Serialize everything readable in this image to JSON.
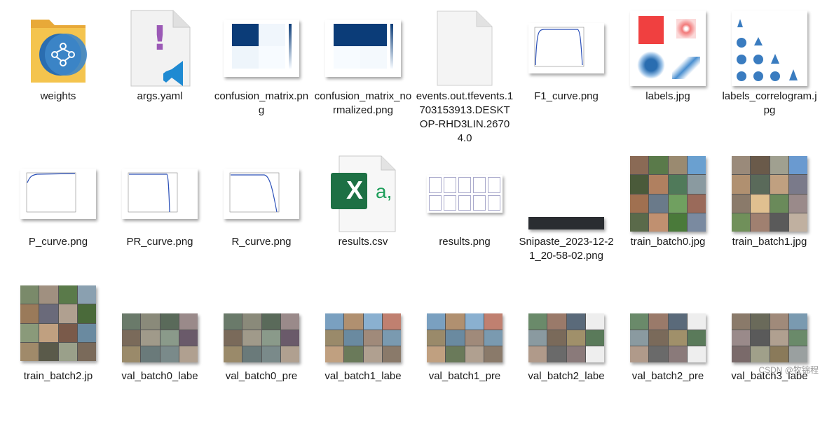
{
  "files": [
    {
      "name": "weights",
      "icon": "folder-icon"
    },
    {
      "name": "args.yaml",
      "icon": "yaml-file-icon"
    },
    {
      "name": "confusion_matrix.png",
      "icon": "confusion-matrix-thumbnail"
    },
    {
      "name": "confusion_matrix_normalized.png",
      "icon": "confusion-matrix-normalized-thumbnail"
    },
    {
      "name": "events.out.tfevents.1703153913.DESKTOP-RHD3LIN.26704.0",
      "icon": "blank-file-icon"
    },
    {
      "name": "F1_curve.png",
      "icon": "f1-curve-thumbnail"
    },
    {
      "name": "labels.jpg",
      "icon": "labels-thumbnail"
    },
    {
      "name": "labels_correlogram.jpg",
      "icon": "correlogram-thumbnail"
    },
    {
      "name": "P_curve.png",
      "icon": "p-curve-thumbnail"
    },
    {
      "name": "PR_curve.png",
      "icon": "pr-curve-thumbnail"
    },
    {
      "name": "R_curve.png",
      "icon": "r-curve-thumbnail"
    },
    {
      "name": "results.csv",
      "icon": "excel-csv-icon",
      "glyph": "X",
      "suffix": "a,"
    },
    {
      "name": "results.png",
      "icon": "results-thumbnail"
    },
    {
      "name": "Snipaste_2023-12-21_20-58-02.png",
      "icon": "snipaste-thumbnail"
    },
    {
      "name": "train_batch0.jpg",
      "icon": "train-batch-thumbnail"
    },
    {
      "name": "train_batch1.jpg",
      "icon": "train-batch-thumbnail"
    },
    {
      "name": "train_batch2.jp",
      "icon": "train-batch-thumbnail"
    },
    {
      "name": "val_batch0_labe",
      "icon": "val-batch-thumbnail"
    },
    {
      "name": "val_batch0_pre",
      "icon": "val-batch-thumbnail"
    },
    {
      "name": "val_batch1_labe",
      "icon": "val-batch-thumbnail"
    },
    {
      "name": "val_batch1_pre",
      "icon": "val-batch-thumbnail"
    },
    {
      "name": "val_batch2_labe",
      "icon": "val-batch-thumbnail"
    },
    {
      "name": "val_batch2_pre",
      "icon": "val-batch-thumbnail"
    },
    {
      "name": "val_batch3_labe",
      "icon": "val-batch-thumbnail"
    }
  ],
  "watermark": "CSDN @牧锦程",
  "colors": {
    "folder": "#f4c44e",
    "vscode": "#1f8ad2",
    "yaml_mark": "#9b59b6",
    "excel": "#1d7044",
    "matrix_dark": "#0b3c78"
  }
}
